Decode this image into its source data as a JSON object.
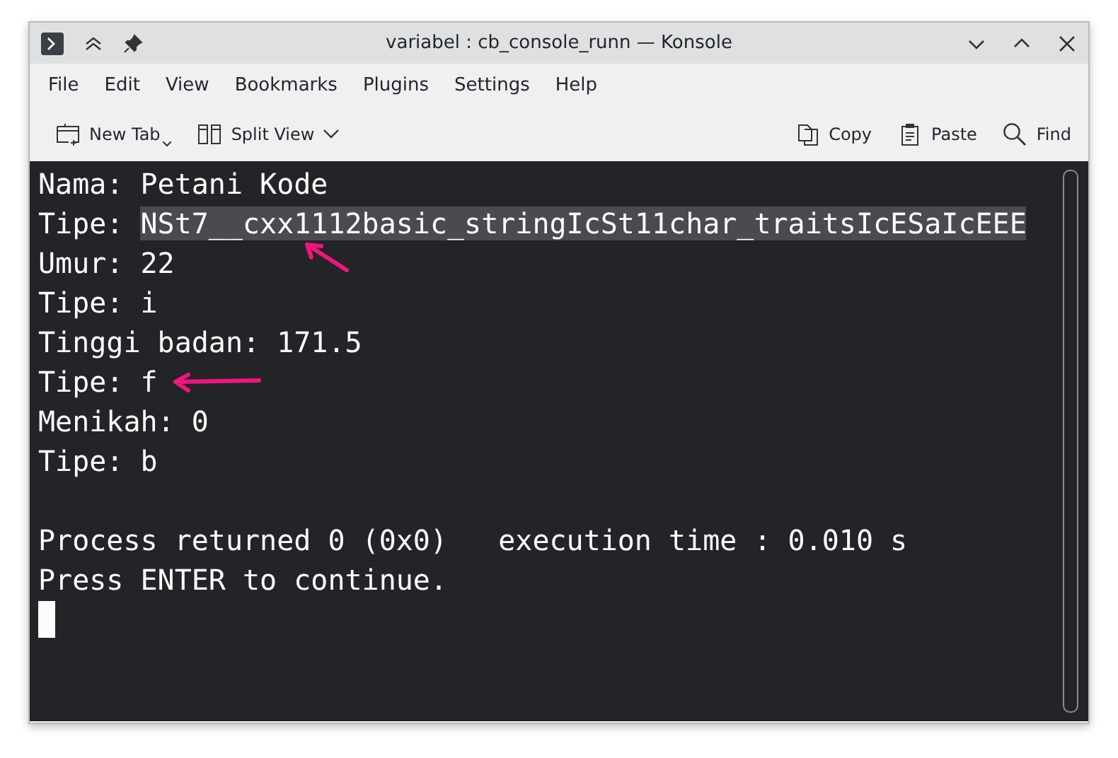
{
  "window": {
    "title": "variabel : cb_console_runn — Konsole"
  },
  "menu": [
    "File",
    "Edit",
    "View",
    "Bookmarks",
    "Plugins",
    "Settings",
    "Help"
  ],
  "toolbar": {
    "left": [
      {
        "label": "New Tab",
        "kind": "new-tab"
      },
      {
        "label": "Split View",
        "kind": "split-view"
      }
    ],
    "right": [
      {
        "label": "Copy",
        "kind": "copy"
      },
      {
        "label": "Paste",
        "kind": "paste"
      },
      {
        "label": "Find",
        "kind": "find"
      }
    ]
  },
  "terminal": {
    "lines": [
      {
        "kind": "text",
        "text": "Nama: Petani Kode"
      },
      {
        "kind": "text",
        "text": "Tipe: ",
        "selection": "NSt7__cxx1112basic_stringIcSt11char_traitsIcESaIcEEE",
        "arrow": {
          "kind": "diagonal"
        }
      },
      {
        "kind": "text",
        "text": "Umur: 22"
      },
      {
        "kind": "text",
        "text": "Tipe: i"
      },
      {
        "kind": "text",
        "text": "Tinggi badan: 171.5"
      },
      {
        "kind": "text",
        "text": "Tipe: f",
        "arrow": {
          "kind": "horizontal"
        }
      },
      {
        "kind": "text",
        "text": "Menikah: 0"
      },
      {
        "kind": "text",
        "text": "Tipe: b"
      },
      {
        "kind": "blank"
      },
      {
        "kind": "text",
        "text": "Process returned 0 (0x0)   execution time : 0.010 s"
      },
      {
        "kind": "text",
        "text": "Press ENTER to continue."
      },
      {
        "kind": "cursor"
      }
    ]
  }
}
